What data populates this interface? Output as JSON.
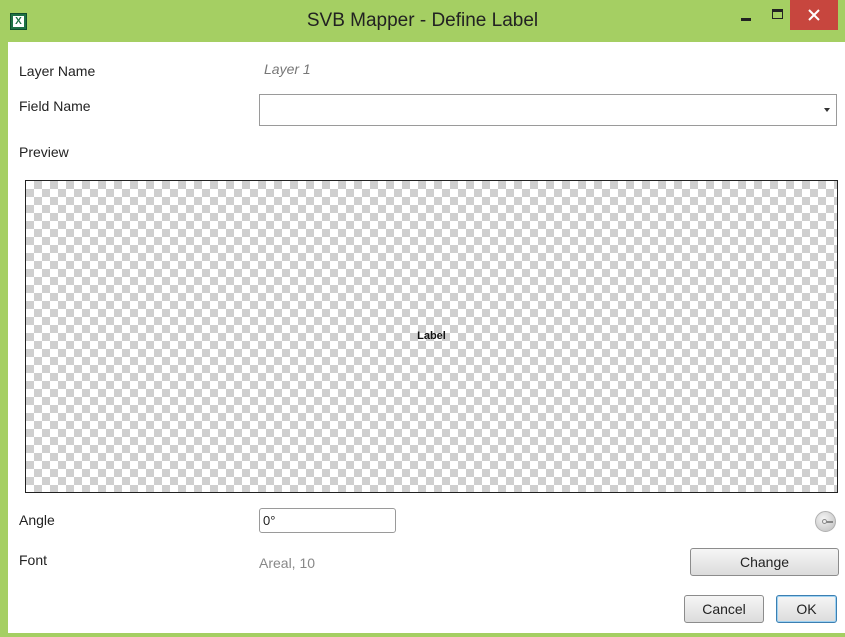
{
  "window": {
    "title": "SVB Mapper - Define Label",
    "app_icon_glyph": "X",
    "minimize_glyph": "–",
    "close_glyph": "×"
  },
  "form": {
    "layer_name_label": "Layer Name",
    "layer_name_value": "Layer 1",
    "field_name_label": "Field Name",
    "field_name_value": "",
    "preview_label": "Preview",
    "preview_text": "Label",
    "angle_label": "Angle",
    "angle_value": "0°",
    "font_label": "Font",
    "font_value": "Areal, 10"
  },
  "buttons": {
    "change": "Change",
    "cancel": "Cancel",
    "ok": "OK"
  },
  "colors": {
    "frame": "#a5cf63",
    "close_button": "#c7463e",
    "ok_border": "#3c7fb1"
  }
}
